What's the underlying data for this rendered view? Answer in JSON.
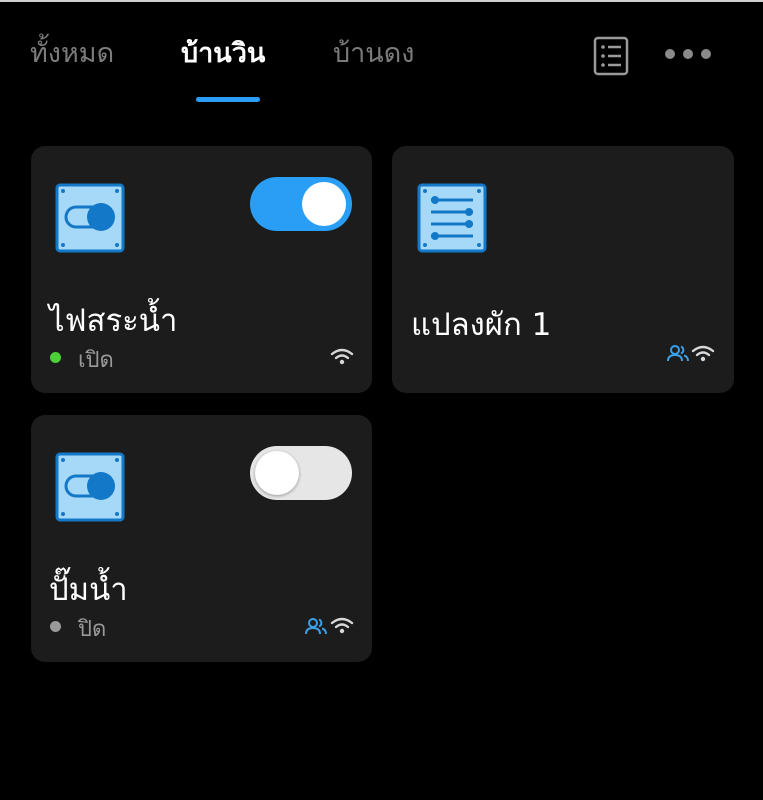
{
  "tabs": [
    {
      "label": "ทั้งหมด",
      "active": false
    },
    {
      "label": "บ้านวิน",
      "active": true
    },
    {
      "label": "บ้านดง",
      "active": false
    }
  ],
  "header_icons": {
    "list": "list-icon",
    "more": "more-icon"
  },
  "colors": {
    "accent": "#2a9df4",
    "status_on": "#4cd137",
    "status_off": "#9a9a9a",
    "card_bg": "#1c1c1c"
  },
  "devices": [
    {
      "name": "ไฟสระน้ำ",
      "status": "เปิด",
      "toggle": "on",
      "icon": "switch-icon"
    },
    {
      "name": "แปลงผัก 1",
      "icon": "settings-sliders-icon"
    },
    {
      "name": "ปั๊มน้ำ",
      "status": "ปิด",
      "toggle": "off",
      "icon": "switch-icon"
    }
  ]
}
